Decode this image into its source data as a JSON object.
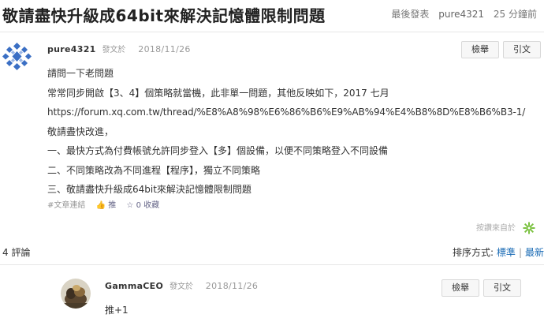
{
  "thread": {
    "title": "敬請盡快升級成64bit來解決記憶體限制問題",
    "last_post_label": "最後發表",
    "last_post_user": "pure4321",
    "last_post_time": "25 分鐘前"
  },
  "post": {
    "username": "pure4321",
    "by_label": "發文於",
    "date": "2018/11/26",
    "report_label": "檢舉",
    "quote_label": "引文",
    "lines": [
      "請問一下老問題",
      "常常同步開啟【3、4】個策略就當機，此非單一問題，其他反映如下，2017 七月",
      "https://forum.xq.com.tw/thread/%E8%A8%98%E6%86%B6%E9%AB%94%E4%B8%8D%E8%B6%B3-1/",
      "敬請盡快改進，",
      "一、最快方式為付費帳號允許同步登入【多】個設備，以便不同策略登入不同設備",
      "二、不同策略改為不同進程【程序】，獨立不同策略",
      "三、敬請盡快升級成64bit來解決記憶體限制問題"
    ],
    "tag_link": "#文章連結",
    "push_label": "推",
    "favorite_count": "0",
    "favorite_label": "收藏",
    "reply_hint": "按讚來自於"
  },
  "comments": {
    "count_label": "4 評論",
    "sort_label": "排序方式:",
    "sort_active": "標準",
    "sort_other": "最新"
  },
  "reply": {
    "username": "GammaCEO",
    "by_label": "發文於",
    "date": "2018/11/26",
    "report_label": "檢舉",
    "quote_label": "引文",
    "text": "推+1"
  },
  "colors": {
    "link": "#1a6bb5",
    "avatar_blue": "#3b6fc4",
    "gear_green": "#7cc242"
  },
  "icons": {
    "push": "thumbs-up-icon",
    "favorite": "star-icon",
    "gear": "gear-icon"
  }
}
